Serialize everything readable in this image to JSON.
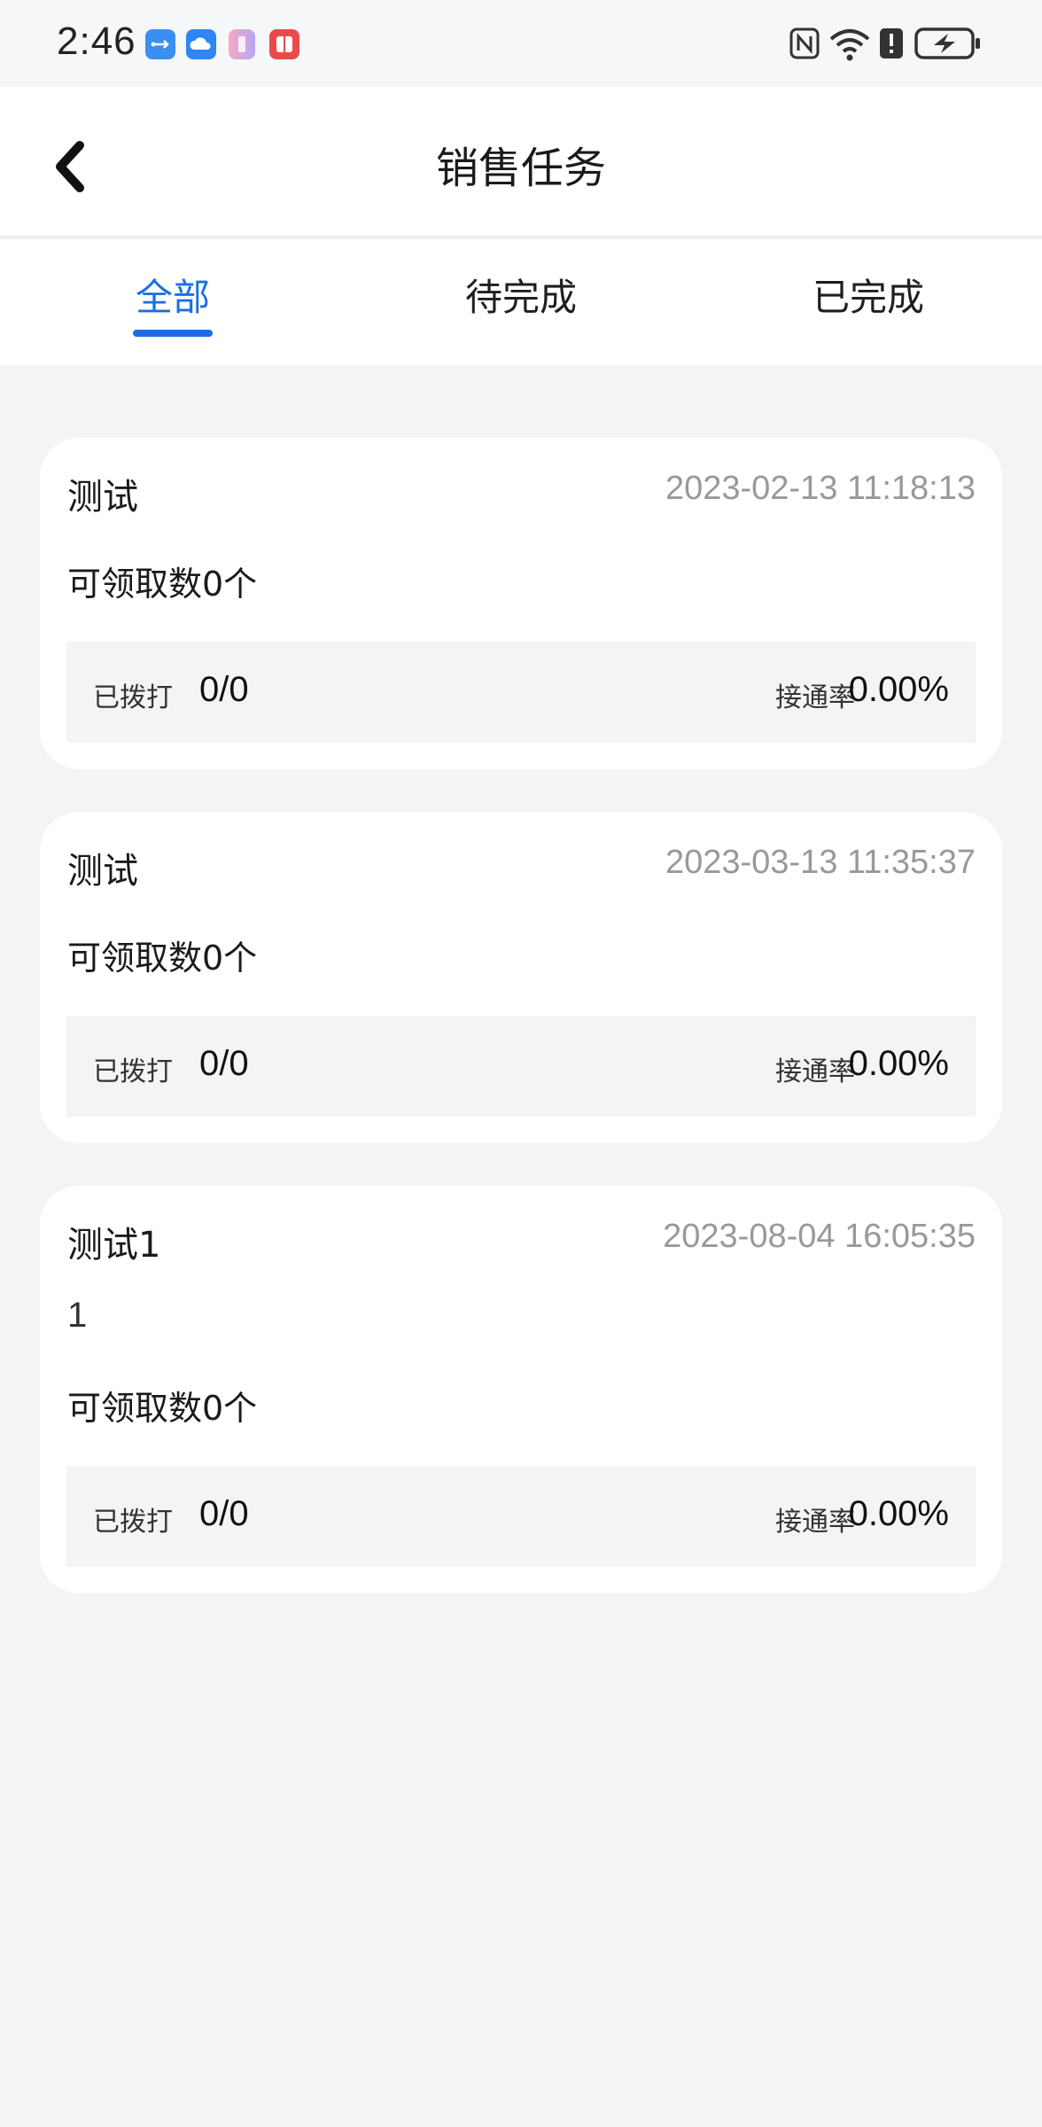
{
  "status_bar": {
    "time": "2:46",
    "icons": [
      "usb-icon",
      "cloud-icon",
      "app-icon",
      "book-icon",
      "nfc-icon",
      "wifi-icon",
      "alert-icon",
      "battery-charging-icon"
    ]
  },
  "header": {
    "title": "销售任务",
    "back_icon": "chevron-left-icon"
  },
  "tabs": [
    {
      "label": "全部",
      "active": true
    },
    {
      "label": "待完成",
      "active": false
    },
    {
      "label": "已完成",
      "active": false
    }
  ],
  "colors": {
    "accent": "#1a6fe0",
    "background": "#f4f4f4",
    "card": "#ffffff",
    "muted_text": "#999999"
  },
  "tasks": [
    {
      "title": "测试",
      "date": "2023-02-13 11:18:13",
      "description": "",
      "claimable": "可领取数0个",
      "dialed_label": "已拨打",
      "dialed_value": "0/0",
      "rate_label": "接通率",
      "rate_value": "0.00%"
    },
    {
      "title": "测试",
      "date": "2023-03-13 11:35:37",
      "description": "",
      "claimable": "可领取数0个",
      "dialed_label": "已拨打",
      "dialed_value": "0/0",
      "rate_label": "接通率",
      "rate_value": "0.00%"
    },
    {
      "title": "测试1",
      "date": "2023-08-04 16:05:35",
      "description": "1",
      "claimable": "可领取数0个",
      "dialed_label": "已拨打",
      "dialed_value": "0/0",
      "rate_label": "接通率",
      "rate_value": "0.00%"
    }
  ]
}
